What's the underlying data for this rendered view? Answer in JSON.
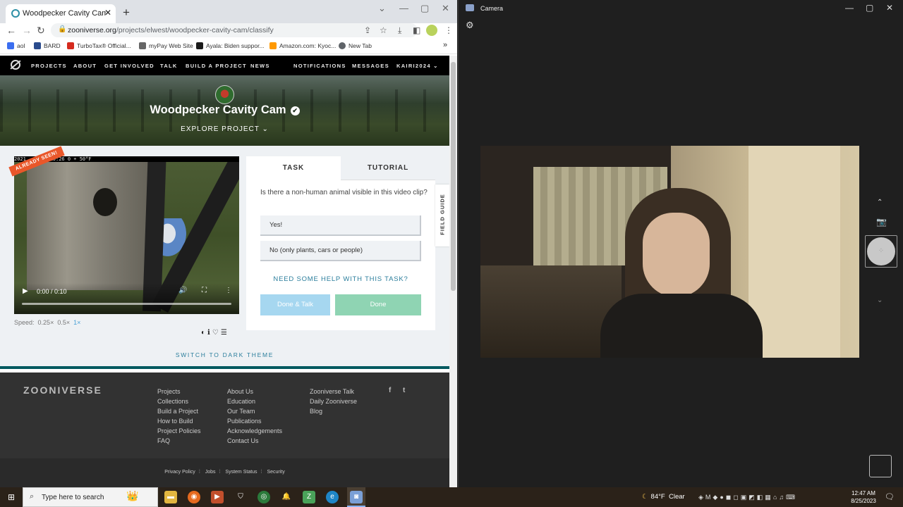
{
  "browser": {
    "tab_title": "Woodpecker Cavity Cam « Classif",
    "tab_close": "✕",
    "new_tab": "+",
    "window_controls": [
      "⌄",
      "—",
      "▢",
      "✕"
    ],
    "url_host": "zooniverse.org",
    "url_path": "/projects/elwest/woodpecker-cavity-cam/classify",
    "bookmarks": [
      {
        "label": "aol",
        "color": "#3b6ef0"
      },
      {
        "label": "BARD",
        "color": "#2a4b8d"
      },
      {
        "label": "TurboTax® Official...",
        "color": "#d52b1e"
      },
      {
        "label": "myPay Web Site",
        "color": "#666666"
      },
      {
        "label": "Ayala: Biden suppor...",
        "color": "#1b1b1b"
      },
      {
        "label": "Amazon.com: Kyoc...",
        "color": "#ff9900"
      },
      {
        "label": "New Tab",
        "color": "#5f6368"
      }
    ],
    "bookmarks_more": "»"
  },
  "zooniverse": {
    "nav": [
      "PROJECTS",
      "ABOUT",
      "GET INVOLVED",
      "TALK",
      "BUILD A PROJECT",
      "NEWS"
    ],
    "nav_right": [
      "NOTIFICATIONS",
      "MESSAGES",
      "KAIRI2024 ⌄"
    ],
    "project_title": "Woodpecker Cavity Cam",
    "verified_icon": "✔",
    "explore": "EXPLORE PROJECT ⌄",
    "already_seen": "ALREADY SEEN!",
    "video": {
      "osd": "2021 ...  21:10:26    0                          ☀ 50°F",
      "time": "0:00 / 0:10",
      "progress": 0.0
    },
    "speed_label": "Speed:",
    "speeds": [
      "0.25×",
      "0.5×",
      "1×"
    ],
    "active_speed": "1×",
    "tabs": [
      "TASK",
      "TUTORIAL"
    ],
    "question": "Is there a non-human animal visible in this video clip?",
    "answers": [
      "Yes!",
      "No (only plants, cars or people)"
    ],
    "help": "NEED SOME HELP WITH THIS TASK?",
    "done_talk": "Done & Talk",
    "done": "Done",
    "field_guide": "FIELD GUIDE",
    "dark_theme": "SWITCH TO DARK THEME",
    "footer": {
      "brand": "ZOONIVERSE",
      "col1": [
        "Projects",
        "Collections",
        "Build a Project",
        "How to Build",
        "Project Policies",
        "FAQ"
      ],
      "col2": [
        "About Us",
        "Education",
        "Our Team",
        "Publications",
        "Acknowledgements",
        "Contact Us"
      ],
      "col3": [
        "Zooniverse Talk",
        "Daily Zooniverse",
        "Blog"
      ],
      "social": [
        "f",
        "t"
      ],
      "legal": [
        "Privacy Policy",
        "Jobs",
        "System Status",
        "Security"
      ]
    }
  },
  "camera": {
    "title": "Camera",
    "window_controls": [
      "—",
      "▢",
      "✕"
    ]
  },
  "taskbar": {
    "search_placeholder": "Type here to search",
    "weather_temp": "84°F",
    "weather_text": "Clear",
    "time": "12:47 AM",
    "date": "8/25/2023"
  }
}
